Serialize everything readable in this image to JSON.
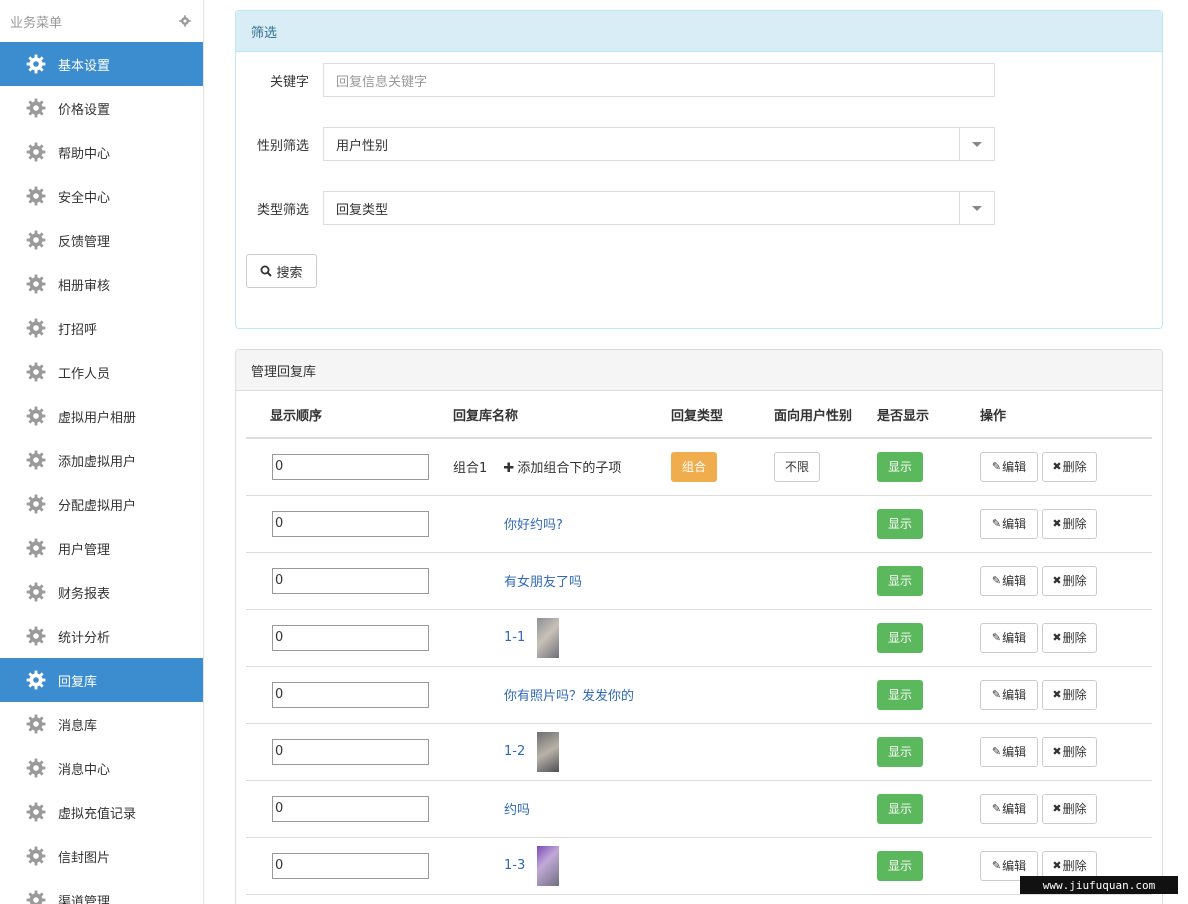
{
  "sidebar": {
    "header": "业务菜单",
    "items": [
      {
        "label": "基本设置",
        "active": true
      },
      {
        "label": "价格设置"
      },
      {
        "label": "帮助中心"
      },
      {
        "label": "安全中心"
      },
      {
        "label": "反馈管理"
      },
      {
        "label": "相册审核"
      },
      {
        "label": "打招呼"
      },
      {
        "label": "工作人员"
      },
      {
        "label": "虚拟用户相册"
      },
      {
        "label": "添加虚拟用户"
      },
      {
        "label": "分配虚拟用户"
      },
      {
        "label": "用户管理"
      },
      {
        "label": "财务报表"
      },
      {
        "label": "统计分析"
      },
      {
        "label": "回复库",
        "active": true
      },
      {
        "label": "消息库"
      },
      {
        "label": "消息中心"
      },
      {
        "label": "虚拟充值记录"
      },
      {
        "label": "信封图片"
      },
      {
        "label": "渠道管理"
      }
    ]
  },
  "filter": {
    "title": "筛选",
    "keyword_label": "关键字",
    "keyword_placeholder": "回复信息关键字",
    "gender_label": "性别筛选",
    "gender_value": "用户性别",
    "type_label": "类型筛选",
    "type_value": "回复类型",
    "search_label": "搜索"
  },
  "library": {
    "title": "管理回复库",
    "columns": [
      "显示顺序",
      "回复库名称",
      "回复类型",
      "面向用户性别",
      "是否显示",
      "操作"
    ],
    "group": {
      "order": "0",
      "name": "组合1",
      "add_label": "添加组合下的子项",
      "type": "组合",
      "gender": "不限",
      "show": "显示"
    },
    "children": [
      {
        "order": "0",
        "name": "你好约吗?",
        "thumb": false,
        "show": "显示"
      },
      {
        "order": "0",
        "name": "有女朋友了吗",
        "thumb": false,
        "show": "显示"
      },
      {
        "order": "0",
        "name": "1-1",
        "thumb": true,
        "show": "显示"
      },
      {
        "order": "0",
        "name": "你有照片吗？发发你的",
        "thumb": false,
        "show": "显示"
      },
      {
        "order": "0",
        "name": "1-2",
        "thumb": true,
        "show": "显示"
      },
      {
        "order": "0",
        "name": "约吗",
        "thumb": false,
        "show": "显示"
      },
      {
        "order": "0",
        "name": "1-3",
        "thumb": true,
        "show": "显示"
      }
    ],
    "edit_label": "编辑",
    "delete_label": "删除"
  },
  "watermark": "www.jiufuquan.com"
}
